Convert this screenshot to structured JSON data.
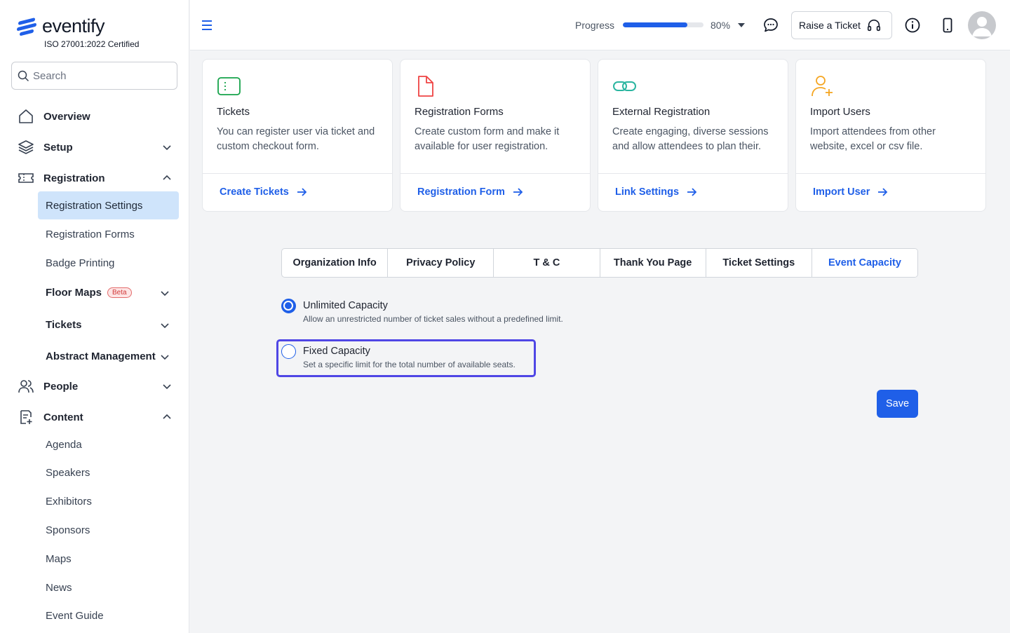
{
  "app": {
    "logo_text": "eventify",
    "certification": "ISO 27001:2022 Certified"
  },
  "search": {
    "placeholder": "Search"
  },
  "sidebar": {
    "overview": "Overview",
    "setup": "Setup",
    "registration": "Registration",
    "registration_children": [
      "Registration Settings",
      "Registration Forms",
      "Badge Printing",
      "Floor Maps",
      "Tickets",
      "Abstract Management"
    ],
    "beta_badge": "Beta",
    "people": "People",
    "content": "Content",
    "content_children": [
      "Agenda",
      "Speakers",
      "Exhibitors",
      "Sponsors",
      "Maps",
      "News",
      "Event Guide"
    ]
  },
  "topbar": {
    "progress_label": "Progress",
    "progress_percent": 80,
    "progress_text": "80%",
    "raise_ticket": "Raise a Ticket"
  },
  "cards": [
    {
      "title": "Tickets",
      "desc": "You can register user via ticket and custom checkout form.",
      "link": "Create Tickets",
      "icon": "ticket-icon",
      "color": "#16a34a"
    },
    {
      "title": "Registration Forms",
      "desc": "Create custom form and make it available for user registration.",
      "link": "Registration Form",
      "icon": "file-icon",
      "color": "#ef4444"
    },
    {
      "title": "External Registration",
      "desc": "Create engaging, diverse sessions and allow attendees to plan their.",
      "link": "Link Settings",
      "icon": "link-icon",
      "color": "#2bb5a0"
    },
    {
      "title": "Import Users",
      "desc": "Import attendees from other website, excel or csv file.",
      "link": "Import User",
      "icon": "user-plus-icon",
      "color": "#f5a623"
    }
  ],
  "tabs": [
    "Organization Info",
    "Privacy Policy",
    "T & C",
    "Thank You Page",
    "Ticket Settings",
    "Event Capacity"
  ],
  "active_tab": "Event Capacity",
  "capacity": {
    "unlimited_title": "Unlimited Capacity",
    "unlimited_desc": "Allow an unrestricted number of ticket sales without a predefined limit.",
    "fixed_title": "Fixed Capacity",
    "fixed_desc": "Set a specific limit for the total number of available seats.",
    "selected": "unlimited"
  },
  "save_label": "Save",
  "colors": {
    "accent": "#1f5fe8",
    "active_bg": "#cfe4fb",
    "focus_ring": "#4f46e5"
  }
}
